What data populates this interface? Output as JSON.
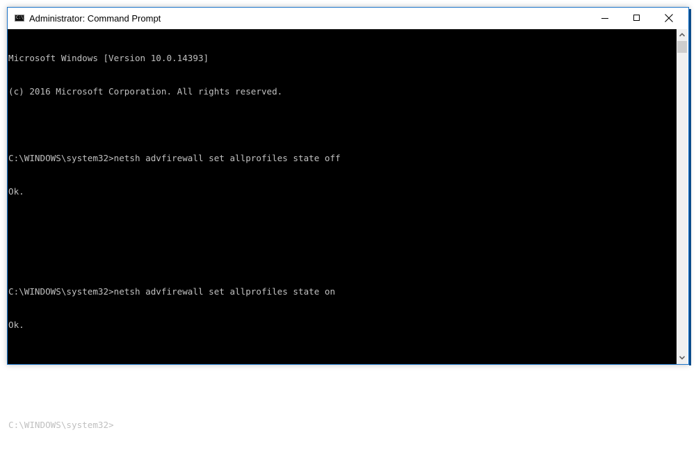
{
  "window": {
    "title": "Administrator: Command Prompt",
    "icon": "cmd-icon",
    "icon_text": "C:\\.",
    "controls": {
      "minimize": "minimize-icon",
      "maximize": "maximize-icon",
      "close": "close-icon"
    }
  },
  "console": {
    "lines": [
      "Microsoft Windows [Version 10.0.14393]",
      "(c) 2016 Microsoft Corporation. All rights reserved.",
      "",
      "C:\\WINDOWS\\system32>netsh advfirewall set allprofiles state off",
      "Ok.",
      "",
      "",
      "C:\\WINDOWS\\system32>netsh advfirewall set allprofiles state on",
      "Ok.",
      "",
      "",
      "C:\\WINDOWS\\system32>"
    ],
    "colors": {
      "background": "#000000",
      "foreground": "#c0c0c0",
      "border": "#1a73c8"
    }
  },
  "scrollbar": {
    "up": "chevron-up-icon",
    "down": "chevron-down-icon"
  }
}
